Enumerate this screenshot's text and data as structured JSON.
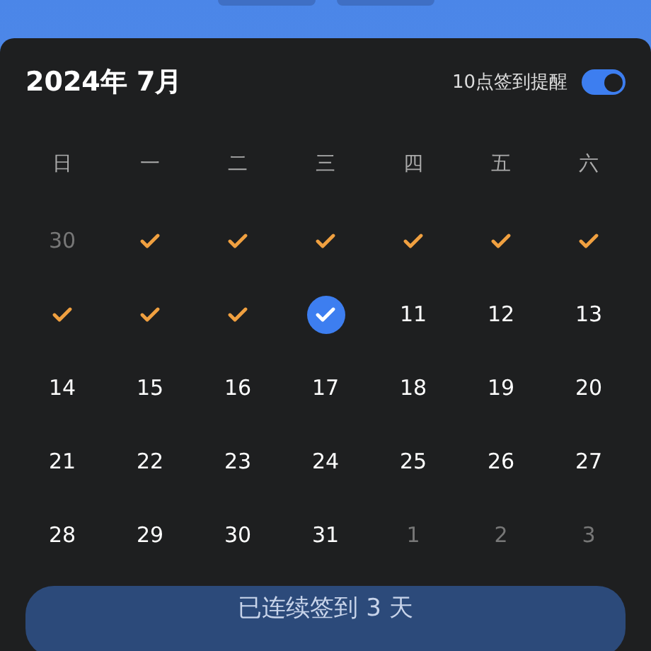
{
  "header": {
    "title": "2024年 7月",
    "reminder": {
      "label": "10点签到提醒",
      "on": true
    }
  },
  "weekdays": [
    "日",
    "一",
    "二",
    "三",
    "四",
    "五",
    "六"
  ],
  "days": [
    {
      "kind": "other",
      "label": "30"
    },
    {
      "kind": "checked"
    },
    {
      "kind": "checked"
    },
    {
      "kind": "checked"
    },
    {
      "kind": "checked"
    },
    {
      "kind": "checked"
    },
    {
      "kind": "checked"
    },
    {
      "kind": "checked"
    },
    {
      "kind": "checked"
    },
    {
      "kind": "checked"
    },
    {
      "kind": "today"
    },
    {
      "kind": "day",
      "label": "11"
    },
    {
      "kind": "day",
      "label": "12"
    },
    {
      "kind": "day",
      "label": "13"
    },
    {
      "kind": "day",
      "label": "14"
    },
    {
      "kind": "day",
      "label": "15"
    },
    {
      "kind": "day",
      "label": "16"
    },
    {
      "kind": "day",
      "label": "17"
    },
    {
      "kind": "day",
      "label": "18"
    },
    {
      "kind": "day",
      "label": "19"
    },
    {
      "kind": "day",
      "label": "20"
    },
    {
      "kind": "day",
      "label": "21"
    },
    {
      "kind": "day",
      "label": "22"
    },
    {
      "kind": "day",
      "label": "23"
    },
    {
      "kind": "day",
      "label": "24"
    },
    {
      "kind": "day",
      "label": "25"
    },
    {
      "kind": "day",
      "label": "26"
    },
    {
      "kind": "day",
      "label": "27"
    },
    {
      "kind": "day",
      "label": "28"
    },
    {
      "kind": "day",
      "label": "29"
    },
    {
      "kind": "day",
      "label": "30"
    },
    {
      "kind": "day",
      "label": "31"
    },
    {
      "kind": "other",
      "label": "1"
    },
    {
      "kind": "other",
      "label": "2"
    },
    {
      "kind": "other",
      "label": "3"
    }
  ],
  "streak_button": {
    "label": "已连续签到 3 天"
  }
}
